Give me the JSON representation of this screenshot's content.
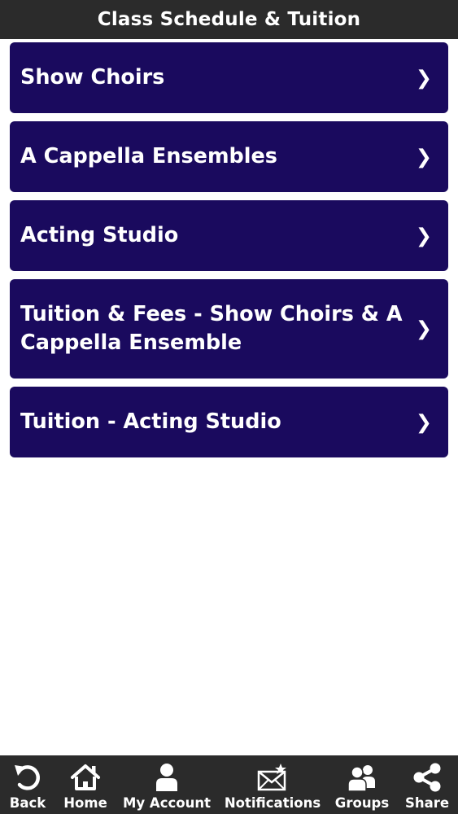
{
  "header": {
    "title": "Class Schedule & Tuition"
  },
  "menu": {
    "items": [
      {
        "label": "Show Choirs",
        "chevron": "❯"
      },
      {
        "label": "A Cappella Ensembles",
        "chevron": "❯"
      },
      {
        "label": "Acting Studio",
        "chevron": "❯"
      },
      {
        "label": "Tuition & Fees - Show Choirs & A Cappella Ensemble",
        "chevron": "❯"
      },
      {
        "label": "Tuition - Acting Studio",
        "chevron": "❯"
      }
    ]
  },
  "bottom_nav": {
    "items": [
      {
        "label": "Back",
        "icon": "undo-arrow-icon"
      },
      {
        "label": "Home",
        "icon": "home-icon"
      },
      {
        "label": "My Account",
        "icon": "user-icon"
      },
      {
        "label": "Notifications",
        "icon": "envelope-star-icon"
      },
      {
        "label": "Groups",
        "icon": "group-icon"
      },
      {
        "label": "Share",
        "icon": "share-icon"
      }
    ]
  },
  "colors": {
    "header_bg": "#2b2b2b",
    "menu_item_bg": "#1a0a5e",
    "page_bg": "#ffffff",
    "text": "#ffffff"
  }
}
